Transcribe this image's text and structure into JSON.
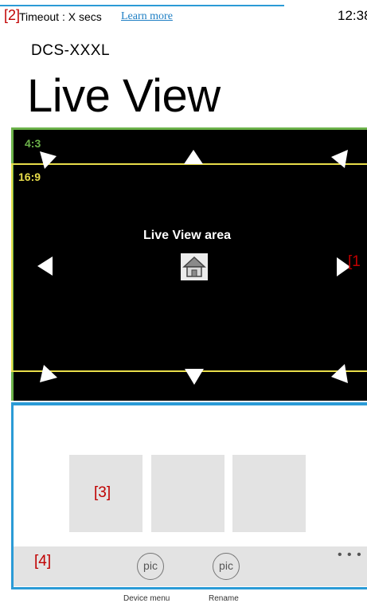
{
  "status_bar": {
    "marker": "[2]",
    "timeout_text": "Timeout : X secs",
    "learn_more_link": "Learn more",
    "time": "12:38"
  },
  "header": {
    "device_name": "DCS-XXXL",
    "page_title": "Live View"
  },
  "live_view": {
    "ratio_4_3_label": "4:3",
    "ratio_16_9_label": "16:9",
    "area_label": "Live View area",
    "marker": "[1",
    "home_icon": "home-icon",
    "colors": {
      "ratio_4_3": "#6cb24a",
      "ratio_16_9": "#e8dd4a",
      "background": "#000000"
    }
  },
  "thumbnails": {
    "marker": "[3]",
    "items": [
      "",
      "",
      ""
    ]
  },
  "app_bar": {
    "marker": "[4]",
    "more_label": "• • •",
    "buttons": [
      {
        "icon_text": "pic",
        "label": "Device menu"
      },
      {
        "icon_text": "pic",
        "label": "Rename"
      }
    ]
  },
  "accent_color": "#2b9bd6",
  "annotation_color": "#c00000"
}
